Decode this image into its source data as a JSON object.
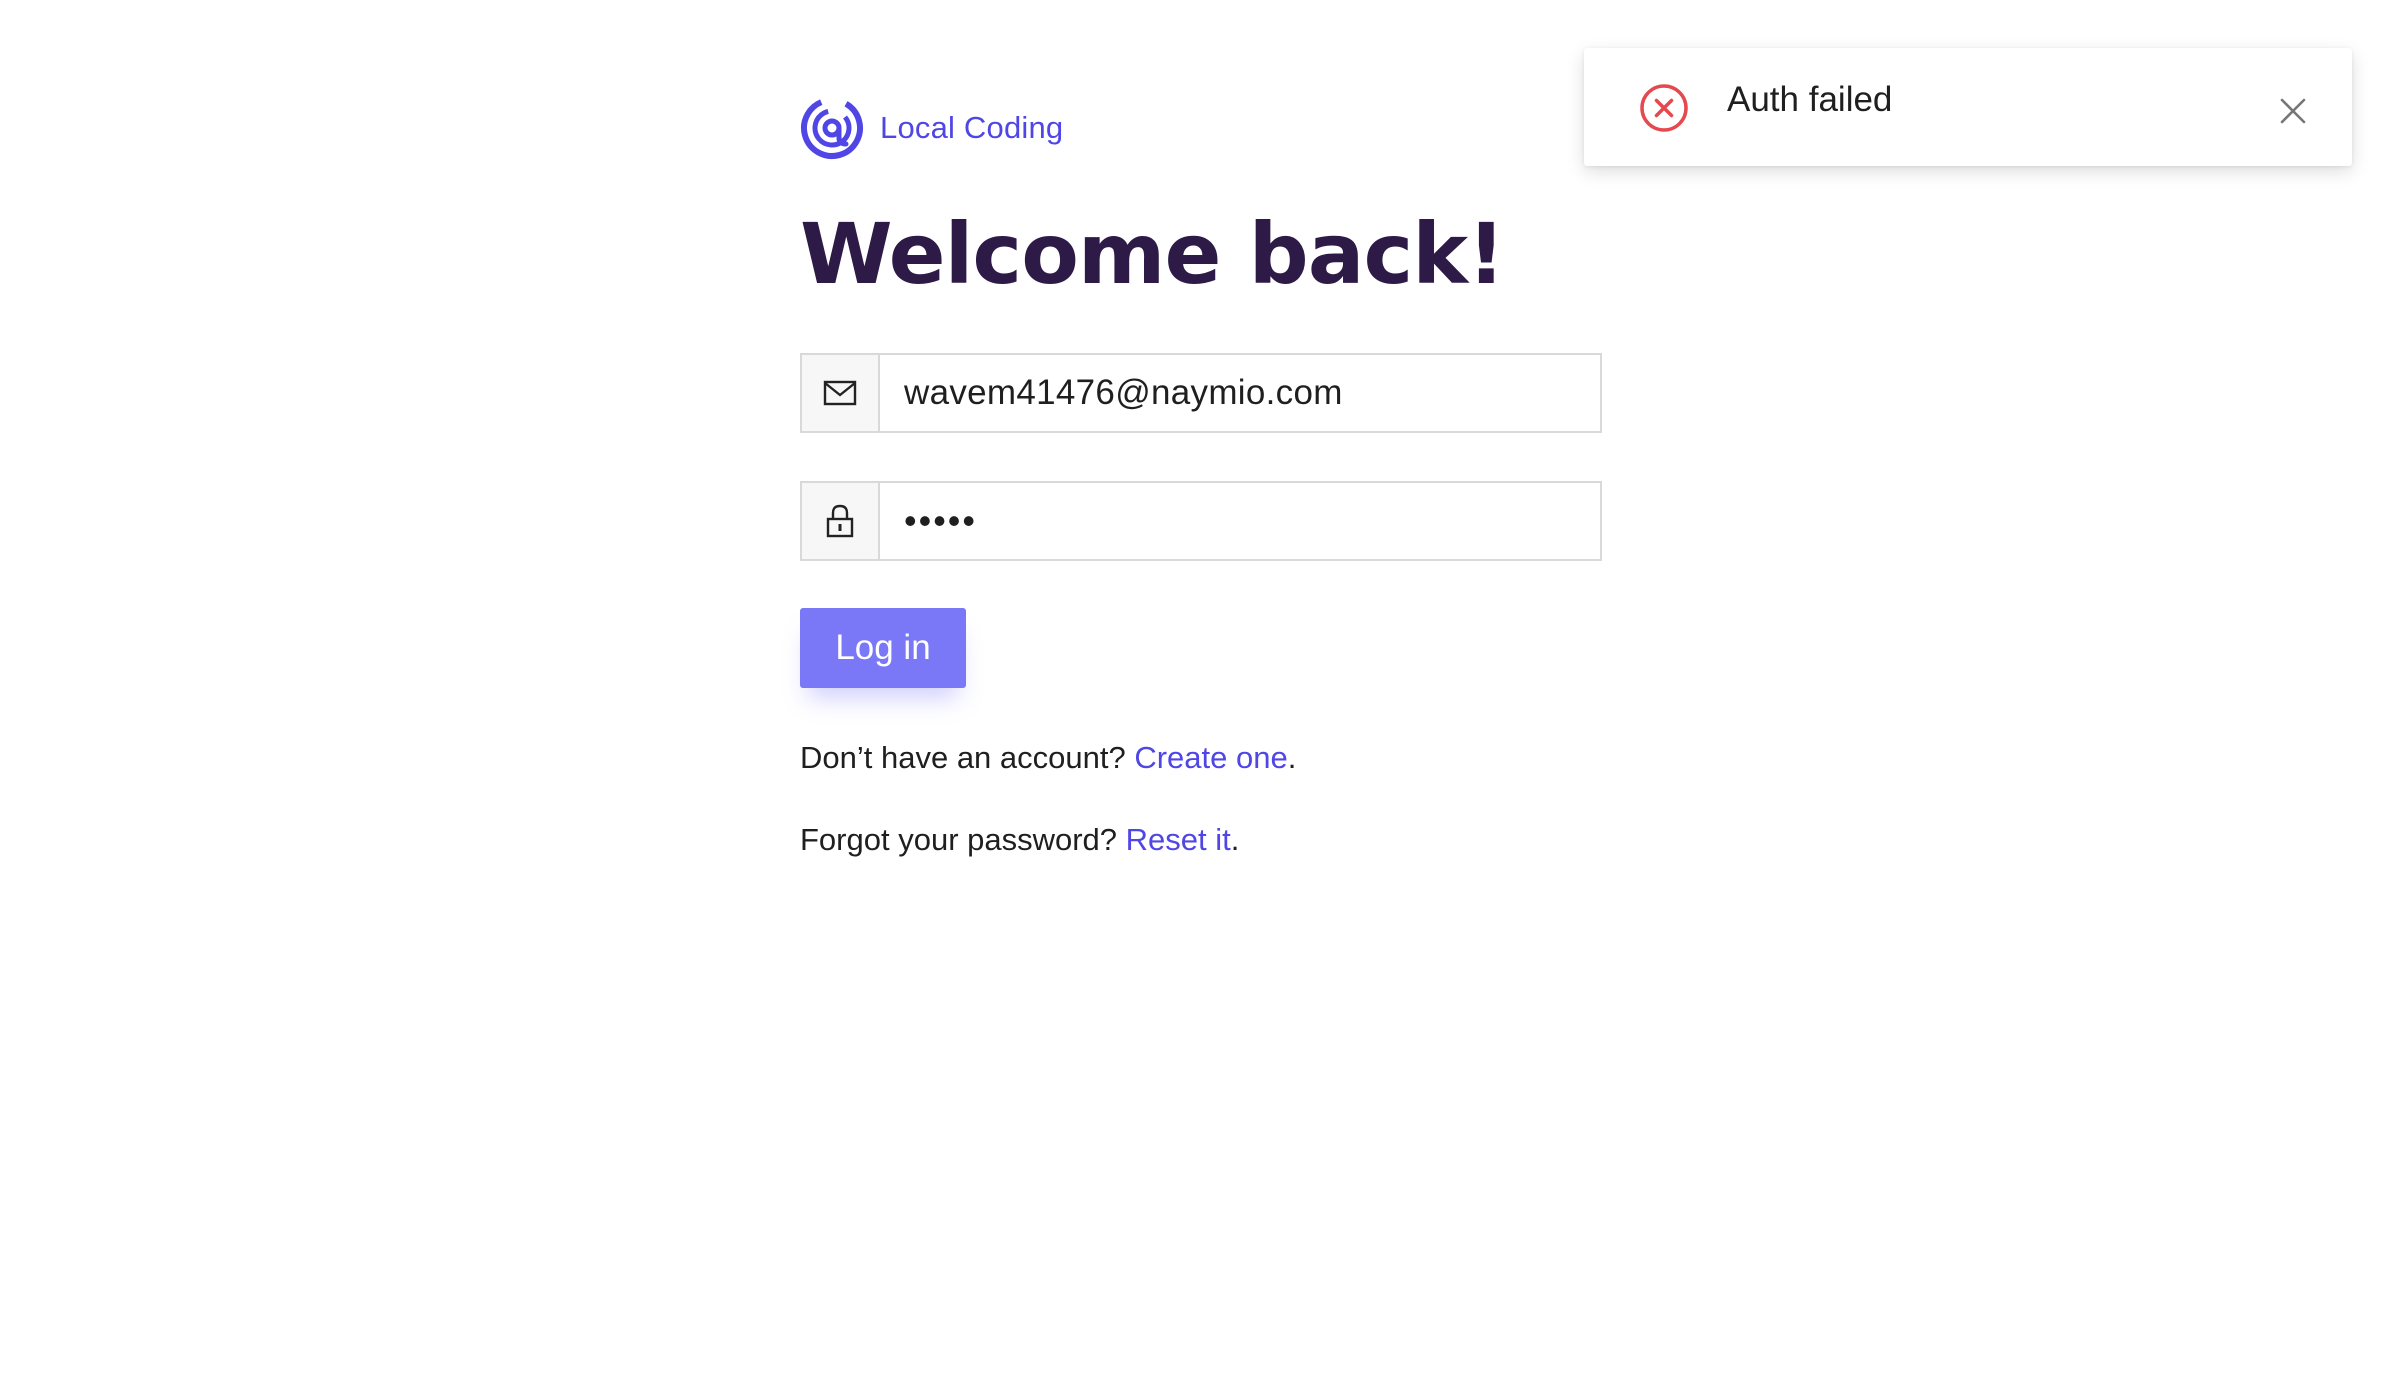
{
  "brand": {
    "name": "Local Coding",
    "accent_color": "#4f46e5",
    "logo_icon": "target-at-logo-icon"
  },
  "login": {
    "title": "Welcome back!",
    "email": {
      "icon": "mail-icon",
      "value": "wavem41476@naymio.com"
    },
    "password": {
      "icon": "lock-icon",
      "value": "•••••"
    },
    "submit_label": "Log in",
    "submit_color": "#7b78f7"
  },
  "footer": {
    "signup_prompt": "Don’t have an account? ",
    "signup_link": "Create one",
    "signup_suffix": ".",
    "reset_prompt": "Forgot your password? ",
    "reset_link": "Reset it",
    "reset_suffix": "."
  },
  "toast": {
    "icon": "error-circle-x-icon",
    "message": "Auth failed",
    "close_icon": "close-icon",
    "error_color": "#e5484d"
  }
}
